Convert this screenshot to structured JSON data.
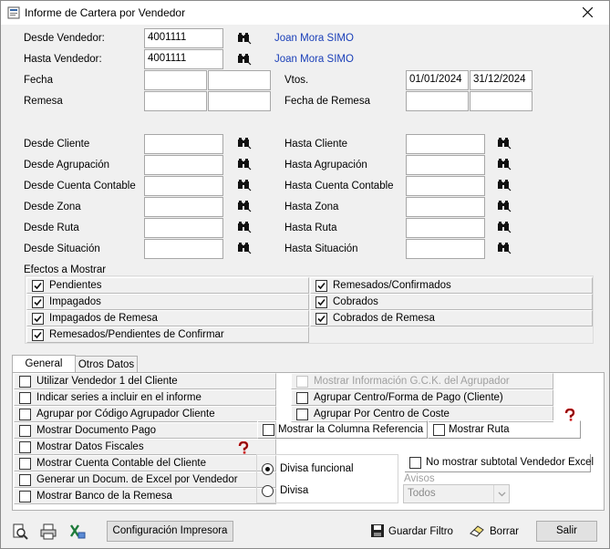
{
  "window": {
    "title": "Informe de Cartera por Vendedor"
  },
  "vendedor": {
    "desde_label": "Desde Vendedor:",
    "desde_value": "4001111",
    "desde_name": "Joan Mora SIMO",
    "hasta_label": "Hasta Vendedor:",
    "hasta_value": "4001111",
    "hasta_name": "Joan Mora SIMO"
  },
  "fechas": {
    "fecha_label": "Fecha",
    "remesa_label": "Remesa",
    "vtos_label": "Vtos.",
    "vtos_desde": "01/01/2024",
    "vtos_hasta": "31/12/2024",
    "fecha_remesa_label": "Fecha de Remesa"
  },
  "rangos": {
    "desde": [
      "Desde Cliente",
      "Desde Agrupación",
      "Desde Cuenta Contable",
      "Desde Zona",
      "Desde Ruta",
      "Desde Situación"
    ],
    "hasta": [
      "Hasta Cliente",
      "Hasta Agrupación",
      "Hasta Cuenta Contable",
      "Hasta Zona",
      "Hasta Ruta",
      "Hasta Situación"
    ]
  },
  "efectos": {
    "title": "Efectos a Mostrar",
    "left": [
      "Pendientes",
      "Impagados",
      "Impagados de Remesa",
      "Remesados/Pendientes de Confirmar"
    ],
    "right": [
      "Remesados/Confirmados",
      "Cobrados",
      "Cobrados de Remesa"
    ]
  },
  "tabs": [
    "General",
    "Otros Datos"
  ],
  "general": {
    "left": [
      "Utilizar Vendedor 1 del Cliente",
      "Indicar series a incluir en el informe",
      "Agrupar por Código Agrupador Cliente",
      "Mostrar Documento Pago",
      "Mostrar Datos Fiscales",
      "Mostrar Cuenta Contable del Cliente",
      "Generar un Docum. de Excel por Vendedor",
      "Mostrar Banco de la Remesa"
    ],
    "right": [
      "Mostrar Información G.C.K. del Agrupador",
      "Agrupar Centro/Forma de Pago (Cliente)",
      "Agrupar Por Centro de Coste"
    ],
    "mostrar_columna_referencia": "Mostrar la Columna Referencia",
    "mostrar_ruta": "Mostrar Ruta",
    "no_mostrar_subtotal": "No mostrar subtotal Vendedor Excel",
    "divisa_funcional": "Divisa funcional",
    "divisa": "Divisa",
    "avisos_label": "Avisos",
    "avisos_value": "Todos"
  },
  "toolbar": {
    "config_impresora": "Configuración Impresora",
    "guardar_filtro": "Guardar Filtro",
    "borrar": "Borrar",
    "salir": "Salir"
  }
}
